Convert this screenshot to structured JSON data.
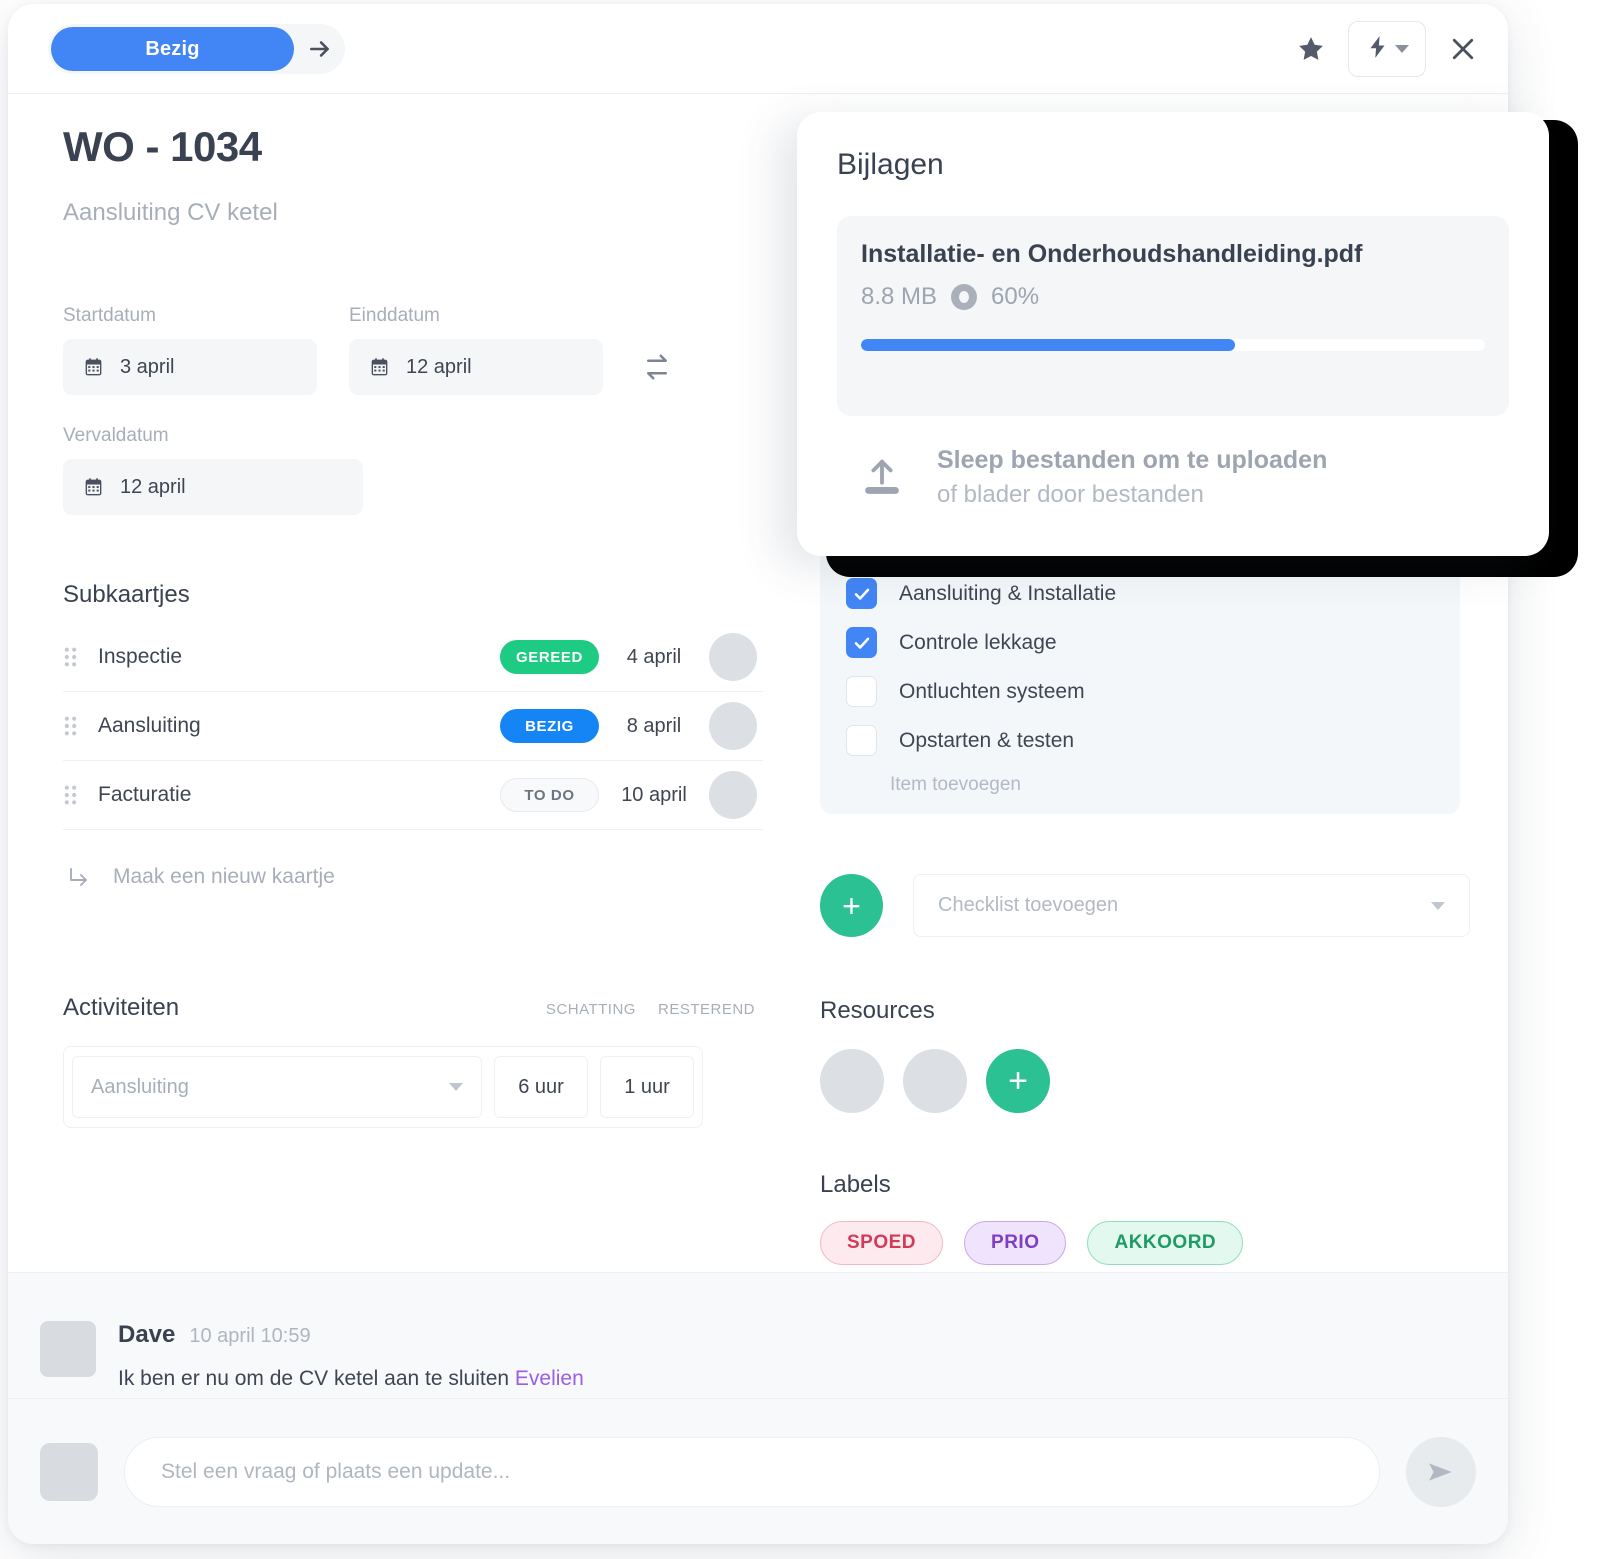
{
  "topbar": {
    "status_label": "Bezig",
    "status_color": "#4285f4",
    "arrow_icon": "arrow-right-icon",
    "star_icon": "star-icon",
    "flash_icon": "lightning-bolt-icon",
    "close_icon": "close-icon"
  },
  "header": {
    "title": "WO - 1034",
    "subtitle": "Aansluiting CV ketel"
  },
  "dates": {
    "start_label": "Startdatum",
    "start_value": "3 april",
    "end_label": "Einddatum",
    "end_value": "12 april",
    "due_label": "Vervaldatum",
    "due_value": "12 april",
    "swap_icon": "swap-arrows-icon",
    "calendar_icon": "calendar-icon"
  },
  "subcards": {
    "title": "Subkaartjes",
    "rows": [
      {
        "name": "Inspectie",
        "status": "GEREED",
        "status_kind": "gereed",
        "date": "4 april",
        "avatar": "female"
      },
      {
        "name": "Aansluiting",
        "status": "BEZIG",
        "status_kind": "bezig",
        "date": "8 april",
        "avatar": "male"
      },
      {
        "name": "Facturatie",
        "status": "TO DO",
        "status_kind": "todo",
        "date": "10 april",
        "avatar": "female"
      }
    ],
    "new_card_label": "Maak een nieuw kaartje",
    "grip_icon": "drag-handle-icon",
    "new_card_icon": "corner-down-right-icon"
  },
  "activities": {
    "title": "Activiteiten",
    "col_estimate": "SCHATTING",
    "col_remaining": "RESTEREND",
    "row": {
      "select_placeholder": "Aansluiting",
      "estimate": "6 uur",
      "remaining": "1 uur"
    }
  },
  "attachments": {
    "title": "Bijlagen",
    "file": {
      "name": "Installatie- en Onderhoudshandleiding.pdf",
      "size": "8.8 MB",
      "percent_label": "60%",
      "percent_value": 60,
      "stop_icon": "stop-upload-icon",
      "bar_color": "#4285f4"
    },
    "dropzone": {
      "primary": "Sleep bestanden om te uploaden",
      "secondary": "of blader door bestanden",
      "icon": "upload-icon"
    }
  },
  "checklist": {
    "items": [
      {
        "label": "Aansluiting & Installatie",
        "checked": true
      },
      {
        "label": "Controle lekkage",
        "checked": true
      },
      {
        "label": "Ontluchten systeem",
        "checked": false
      },
      {
        "label": "Opstarten & testen",
        "checked": false
      }
    ],
    "add_item_label": "Item toevoegen",
    "add_checklist_placeholder": "Checklist toevoegen",
    "add_button_label": "+",
    "accent_color": "#2bc192",
    "check_color": "#4285f4"
  },
  "resources": {
    "title": "Resources",
    "avatars": [
      "female",
      "male"
    ],
    "add_button_label": "+"
  },
  "labels": {
    "title": "Labels",
    "items": [
      {
        "text": "SPOED",
        "kind": "spoed"
      },
      {
        "text": "PRIO",
        "kind": "prio"
      },
      {
        "text": "AKKOORD",
        "kind": "akkoord"
      }
    ]
  },
  "comments": {
    "items": [
      {
        "author": "Dave",
        "time": "10 april 10:59",
        "text": "Ik ben er nu om de CV ketel aan te sluiten ",
        "mention": "Evelien",
        "avatar": "male"
      }
    ],
    "composer": {
      "placeholder": "Stel een vraag of plaats een update...",
      "avatar": "female",
      "send_icon": "send-icon"
    }
  }
}
